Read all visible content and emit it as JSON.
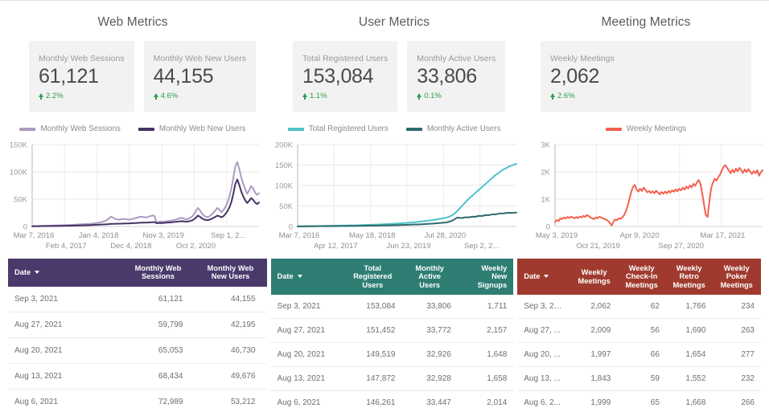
{
  "panels": [
    {
      "title": "Web Metrics",
      "kpis": [
        {
          "label": "Monthly Web Sessions",
          "value": "61,121",
          "delta": "2.2%"
        },
        {
          "label": "Monthly Web New Users",
          "value": "44,155",
          "delta": "4.6%"
        }
      ],
      "legend": [
        {
          "text": "Monthly Web Sessions",
          "color": "#a99bc1"
        },
        {
          "text": "Monthly Web New Users",
          "color": "#463366"
        }
      ]
    },
    {
      "title": "User Metrics",
      "kpis": [
        {
          "label": "Total Registered Users",
          "value": "153,084",
          "delta": "1.1%"
        },
        {
          "label": "Monthly Active Users",
          "value": "33,806",
          "delta": "0.1%"
        }
      ],
      "legend": [
        {
          "text": "Total Registered Users",
          "color": "#4ec3c8"
        },
        {
          "text": "Monthly Active Users",
          "color": "#2d6b6e"
        }
      ]
    },
    {
      "title": "Meeting Metrics",
      "kpis": [
        {
          "label": "Weekly Meetings",
          "value": "2,062",
          "delta": "2.6%"
        }
      ],
      "legend": [
        {
          "text": "Weekly Meetings",
          "color": "#f4604f"
        }
      ]
    }
  ],
  "chart_data": [
    {
      "type": "line",
      "title": "Web Metrics",
      "xlabel": "",
      "ylabel": "",
      "ylim": [
        0,
        150000
      ],
      "yticks": [
        "0",
        "50K",
        "100K",
        "150K"
      ],
      "xticks_top": [
        "Mar 7, 2016",
        "Jan 4, 2018",
        "Nov 3, 2019",
        "Sep 1, 2..."
      ],
      "xticks_bottom": [
        "Feb 4, 2017",
        "Dec 4, 2018",
        "Oct 2, 2020"
      ],
      "grid": true,
      "legend_position": "top",
      "series": [
        {
          "name": "Monthly Web Sessions",
          "color": "#a99bc1",
          "values": [
            600,
            700,
            800,
            900,
            1000,
            1100,
            1200,
            1300,
            1400,
            1500,
            1600,
            1800,
            1900,
            2000,
            2100,
            2200,
            2400,
            2500,
            2600,
            2800,
            3000,
            3200,
            3400,
            3600,
            3800,
            4000,
            4200,
            4400,
            4600,
            4800,
            5000,
            5500,
            6000,
            6500,
            7000,
            8000,
            9000,
            10000,
            12000,
            15000,
            18000,
            16000,
            14000,
            13000,
            12500,
            13000,
            14000,
            13500,
            13000,
            12500,
            13000,
            14000,
            15000,
            16000,
            17000,
            18000,
            17500,
            17000,
            16500,
            18000,
            19000,
            20000,
            19500,
            8000,
            8500,
            9000,
            8500,
            9000,
            9500,
            10000,
            10500,
            11000,
            12000,
            13000,
            14000,
            15000,
            16000,
            14000,
            13000,
            14000,
            16000,
            18000,
            22000,
            28000,
            34000,
            30000,
            24000,
            20000,
            18000,
            17000,
            19000,
            22000,
            26000,
            30000,
            34000,
            30000,
            26000,
            30000,
            36000,
            44000,
            55000,
            70000,
            90000,
            110000,
            118000,
            105000,
            90000,
            78000,
            68000,
            60000,
            66000,
            74000,
            70000,
            62000,
            58000,
            61000
          ]
        },
        {
          "name": "Monthly Web New Users",
          "color": "#463366",
          "values": [
            400,
            450,
            500,
            550,
            600,
            650,
            700,
            750,
            800,
            850,
            900,
            950,
            1000,
            1050,
            1100,
            1150,
            1200,
            1250,
            1300,
            1400,
            1500,
            1600,
            1700,
            1800,
            1900,
            2000,
            2100,
            2200,
            2300,
            2400,
            2500,
            2700,
            2900,
            3100,
            3300,
            3500,
            3700,
            3900,
            4100,
            4400,
            4700,
            4800,
            4900,
            5000,
            5100,
            5200,
            5400,
            5500,
            5600,
            5700,
            5900,
            6100,
            6300,
            6500,
            6700,
            6900,
            7000,
            7100,
            7200,
            7400,
            7600,
            7800,
            8000,
            6000,
            6200,
            6500,
            6300,
            6600,
            6900,
            7200,
            7500,
            7800,
            8200,
            8600,
            9000,
            9400,
            9800,
            9200,
            8800,
            9200,
            10000,
            11000,
            13000,
            16000,
            20000,
            18000,
            15000,
            13000,
            12000,
            11500,
            12500,
            14000,
            16000,
            18000,
            20000,
            18500,
            17000,
            19000,
            23000,
            28000,
            35000,
            45000,
            60000,
            78000,
            86000,
            76000,
            64000,
            55000,
            48000,
            43000,
            47000,
            52000,
            49000,
            44000,
            41000,
            44000
          ]
        }
      ]
    },
    {
      "type": "line",
      "title": "User Metrics",
      "xlabel": "",
      "ylabel": "",
      "ylim": [
        0,
        200000
      ],
      "yticks": [
        "0",
        "50K",
        "100K",
        "150K",
        "200K"
      ],
      "xticks_top": [
        "Mar 7, 2016",
        "May 18, 2018",
        "Jul 28, 2020"
      ],
      "xticks_bottom": [
        "Apr 12, 2017",
        "Jun 23, 2019",
        "Sep 2, 2..."
      ],
      "grid": true,
      "legend_position": "top",
      "series": [
        {
          "name": "Total Registered Users",
          "color": "#4ec3c8",
          "values": [
            300,
            400,
            500,
            600,
            700,
            800,
            900,
            1000,
            1100,
            1200,
            1300,
            1400,
            1500,
            1600,
            1700,
            1800,
            1900,
            2000,
            2100,
            2200,
            2300,
            2400,
            2500,
            2600,
            2700,
            2800,
            3000,
            3200,
            3400,
            3600,
            3800,
            4000,
            4200,
            4400,
            4600,
            4800,
            5000,
            5300,
            5600,
            5900,
            6200,
            6500,
            6800,
            7100,
            7500,
            7900,
            8300,
            8700,
            9100,
            9600,
            10100,
            10600,
            11200,
            11800,
            12400,
            13000,
            13700,
            14400,
            15200,
            16000,
            16900,
            17800,
            18800,
            19800,
            21000,
            22500,
            24500,
            27000,
            31000,
            36000,
            42000,
            48000,
            54000,
            60000,
            66000,
            71000,
            76000,
            81000,
            86000,
            91000,
            96000,
            101000,
            106000,
            111000,
            116000,
            121000,
            126000,
            130000,
            134000,
            138000,
            141000,
            144000,
            147000,
            149000,
            151000,
            153084
          ]
        },
        {
          "name": "Monthly Active Users",
          "color": "#2d6b6e",
          "values": [
            200,
            250,
            300,
            350,
            400,
            450,
            500,
            550,
            600,
            650,
            700,
            750,
            800,
            850,
            900,
            950,
            1000,
            1050,
            1100,
            1150,
            1200,
            1250,
            1300,
            1350,
            1400,
            1450,
            1500,
            1600,
            1700,
            1800,
            1900,
            2000,
            2100,
            2200,
            2300,
            2400,
            2500,
            2600,
            2700,
            2800,
            2900,
            3000,
            3100,
            3200,
            3400,
            3600,
            3800,
            4000,
            4200,
            4400,
            4600,
            4800,
            5000,
            5200,
            5500,
            5800,
            6100,
            6400,
            6800,
            7200,
            7600,
            8000,
            8500,
            9000,
            9500,
            10500,
            12000,
            14000,
            17000,
            21000,
            21500,
            20500,
            21500,
            22500,
            22000,
            23000,
            24000,
            23500,
            25000,
            26000,
            25500,
            27000,
            28000,
            27500,
            29000,
            30000,
            29500,
            31000,
            32000,
            31500,
            32500,
            33000,
            33500,
            33000,
            33500,
            33806
          ]
        }
      ]
    },
    {
      "type": "line",
      "title": "Meeting Metrics",
      "xlabel": "",
      "ylabel": "",
      "ylim": [
        0,
        3000
      ],
      "yticks": [
        "0",
        "1K",
        "2K",
        "3K"
      ],
      "xticks_top": [
        "May 3, 2019",
        "Apr 9, 2020",
        "Mar 17, 2021"
      ],
      "xticks_bottom": [
        "Oct 21, 2019",
        "Sep 27, 2020"
      ],
      "grid": true,
      "legend_position": "top",
      "series": [
        {
          "name": "Weekly Meetings",
          "color": "#f4604f",
          "values": [
            170,
            230,
            200,
            300,
            270,
            330,
            290,
            350,
            310,
            360,
            330,
            300,
            340,
            310,
            360,
            330,
            390,
            350,
            420,
            380,
            330,
            300,
            270,
            330,
            300,
            360,
            330,
            300,
            270,
            240,
            200,
            120,
            40,
            180,
            260,
            230,
            300,
            280,
            340,
            420,
            560,
            760,
            1020,
            1280,
            1450,
            1520,
            1350,
            1280,
            1380,
            1300,
            1420,
            1340,
            1250,
            1300,
            1230,
            1290,
            1220,
            1310,
            1240,
            1180,
            1260,
            1200,
            1280,
            1210,
            1300,
            1240,
            1330,
            1270,
            1360,
            1290,
            1380,
            1320,
            1420,
            1350,
            1460,
            1390,
            1500,
            1430,
            1560,
            1490,
            1620,
            1700,
            1560,
            1200,
            800,
            420,
            350,
            900,
            1400,
            1600,
            1750,
            1680,
            1800,
            1900,
            2050,
            2180,
            2250,
            2150,
            2050,
            1950,
            2080,
            1980,
            2120,
            2020,
            2150,
            2060,
            1960,
            2090,
            1990,
            2100,
            2010,
            1920,
            2030,
            1950,
            2060,
            1860,
            1980,
            2062
          ]
        }
      ]
    }
  ],
  "tables": [
    {
      "name": "web-metrics-table",
      "header_color": "#4a3a6b",
      "columns": [
        "Date",
        "Monthly Web Sessions",
        "Monthly Web New Users"
      ],
      "rows": [
        [
          "Sep 3, 2021",
          "61,121",
          "44,155"
        ],
        [
          "Aug 27, 2021",
          "59,799",
          "42,195"
        ],
        [
          "Aug 20, 2021",
          "65,053",
          "46,730"
        ],
        [
          "Aug 13, 2021",
          "68,434",
          "49,676"
        ],
        [
          "Aug 6, 2021",
          "72,989",
          "53,212"
        ]
      ]
    },
    {
      "name": "user-metrics-table",
      "header_color": "#2e7d73",
      "columns": [
        "Date",
        "Total Registered Users",
        "Monthly Active Users",
        "Weekly New Signups"
      ],
      "rows": [
        [
          "Sep 3, 2021",
          "153,084",
          "33,806",
          "1,711"
        ],
        [
          "Aug 27, 2021",
          "151,452",
          "33,772",
          "2,157"
        ],
        [
          "Aug 20, 2021",
          "149,519",
          "32,926",
          "1,648"
        ],
        [
          "Aug 13, 2021",
          "147,872",
          "32,928",
          "1,658"
        ],
        [
          "Aug 6, 2021",
          "146,261",
          "33,447",
          "2,014"
        ]
      ]
    },
    {
      "name": "meeting-metrics-table",
      "header_color": "#a03a2e",
      "columns": [
        "Date",
        "Weekly Meetings",
        "Weekly Check-In Meetings",
        "Weekly Retro Meetings",
        "Weekly Poker Meetings"
      ],
      "rows": [
        [
          "Sep 3, 20...",
          "2,062",
          "62",
          "1,766",
          "234"
        ],
        [
          "Aug 27, ...",
          "2,009",
          "56",
          "1,690",
          "263"
        ],
        [
          "Aug 20, ...",
          "1,997",
          "66",
          "1,654",
          "277"
        ],
        [
          "Aug 13, ...",
          "1,843",
          "59",
          "1,552",
          "232"
        ],
        [
          "Aug 6, 2...",
          "1,999",
          "65",
          "1,668",
          "266"
        ]
      ]
    }
  ]
}
